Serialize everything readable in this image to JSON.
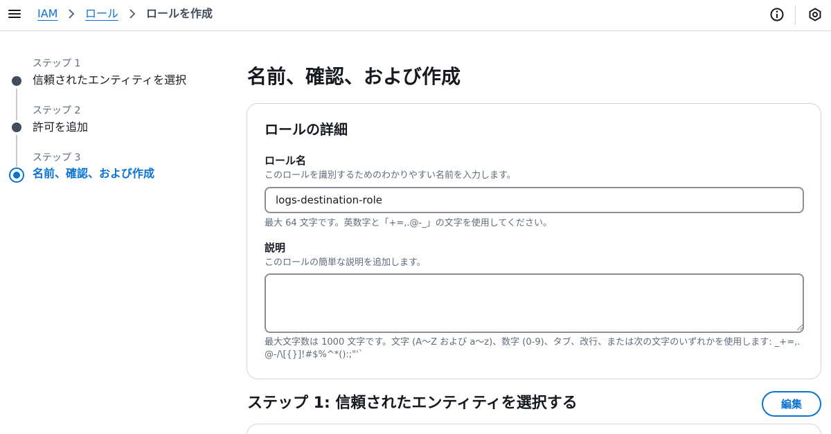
{
  "breadcrumb": {
    "items": [
      "IAM",
      "ロール"
    ],
    "current": "ロールを作成"
  },
  "steps": [
    {
      "label": "ステップ 1",
      "title": "信頼されたエンティティを選択"
    },
    {
      "label": "ステップ 2",
      "title": "許可を追加"
    },
    {
      "label": "ステップ 3",
      "title": "名前、確認、および作成"
    }
  ],
  "page": {
    "title": "名前、確認、および作成"
  },
  "role_details": {
    "title": "ロールの詳細",
    "name_label": "ロール名",
    "name_desc": "このロールを識別するためのわかりやすい名前を入力します。",
    "name_value": "logs-destination-role",
    "name_constraint": "最大 64 文字です。英数字と「+=,.@-_」の文字を使用してください。",
    "desc_label": "説明",
    "desc_desc": "このロールの簡単な説明を追加します。",
    "desc_value": "",
    "desc_constraint": "最大文字数は 1000 文字です。文字 (A〜Z および a〜z)、数字 (0-9)、タブ、改行、または次の文字のいずれかを使用します: _+=,. @-/\\[{}]!#$%^*():;\"'`"
  },
  "step1_section": {
    "title": "ステップ 1: 信頼されたエンティティを選択する",
    "edit_label": "編集"
  },
  "icons": {
    "menu": "menu-icon",
    "info": "info-icon",
    "notifications": "hexagon-icon"
  },
  "colors": {
    "accent": "#0972d3",
    "text": "#16191f",
    "muted": "#5f6b7a",
    "step_done": "#414d5c"
  }
}
